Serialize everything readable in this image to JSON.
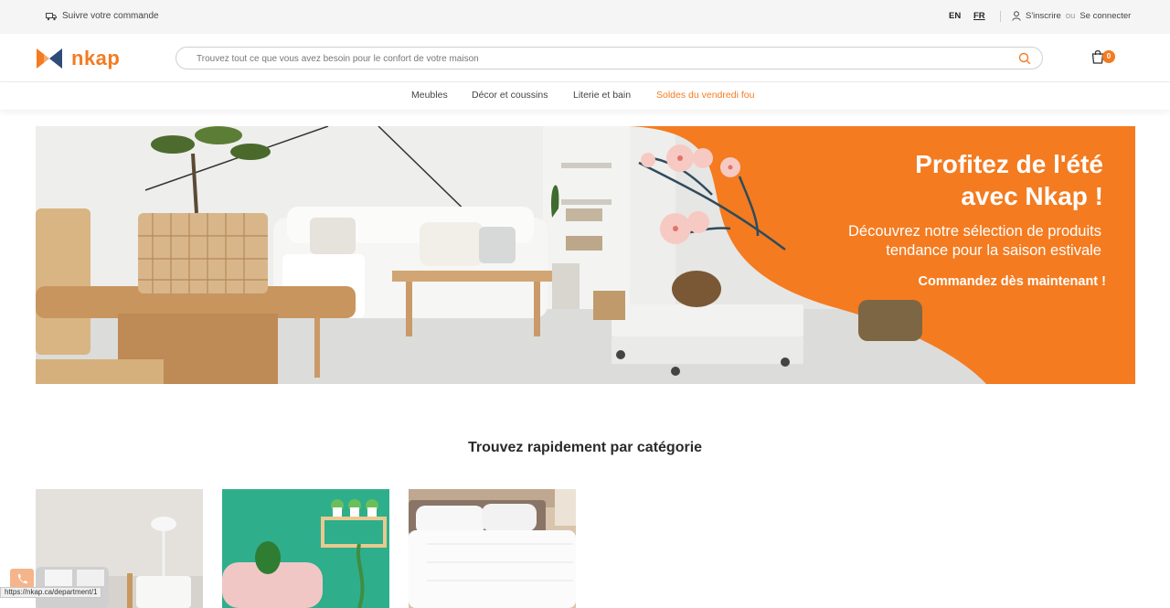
{
  "colors": {
    "brand": "#f47b20",
    "brand_blue": "#2f4b7c",
    "text": "#333333"
  },
  "topbar": {
    "track_icon": "truck-icon",
    "track_label": "Suivre votre commande",
    "lang_en": "EN",
    "lang_fr": "FR",
    "user_icon": "user-icon",
    "signup": "S'inscrire",
    "or": "ou",
    "login": "Se connecter"
  },
  "header": {
    "logo_text": "nkap",
    "search_placeholder": "Trouvez tout ce que vous avez besoin pour le confort de votre maison",
    "search_icon": "search-icon",
    "cart_icon": "shopping-bag-icon",
    "cart_count": "0"
  },
  "nav": {
    "items": [
      {
        "label": "Meubles"
      },
      {
        "label": "Décor et coussins"
      },
      {
        "label": "Literie et bain"
      },
      {
        "label": "Soldes du vendredi fou"
      }
    ]
  },
  "banner": {
    "title_line1": "Profitez de l'été",
    "title_line2": "avec Nkap !",
    "sub_line1": "Découvrez notre sélection de produits",
    "sub_line2": "tendance pour la saison estivale",
    "cta": "Commandez dès maintenant !"
  },
  "categories": {
    "title": "Trouvez rapidement par catégorie"
  },
  "status_url": "https://nkap.ca/department/1",
  "phone_icon": "phone-icon"
}
